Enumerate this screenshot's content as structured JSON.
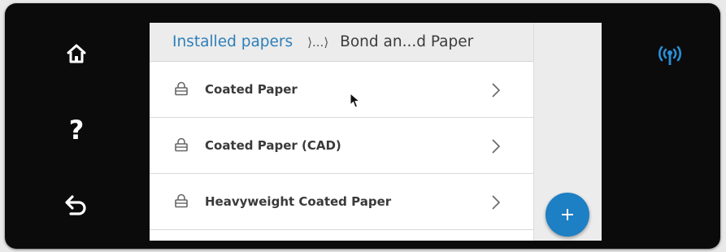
{
  "breadcrumb": {
    "root": "Installed papers",
    "ellipsis": "⟩...⟩",
    "current": "Bond an...d Paper"
  },
  "papers": [
    {
      "label": "Coated Paper",
      "icon": "lock-icon",
      "trailing_icon": "chevron-right-icon"
    },
    {
      "label": "Coated Paper (CAD)",
      "icon": "lock-icon",
      "trailing_icon": "chevron-right-icon"
    },
    {
      "label": "Heavyweight Coated Paper",
      "icon": "lock-icon",
      "trailing_icon": "chevron-right-icon"
    }
  ],
  "nav": {
    "home_icon": "home-icon",
    "help_label": "?",
    "back_icon": "back-arrow-icon"
  },
  "status": {
    "wireless_icon": "wireless-icon"
  },
  "fab": {
    "label": "+"
  },
  "colors": {
    "accent": "#2d7fb8",
    "fab": "#1d7fc4",
    "wireless": "#2a8fd8",
    "bezel": "#0b0b0b"
  }
}
